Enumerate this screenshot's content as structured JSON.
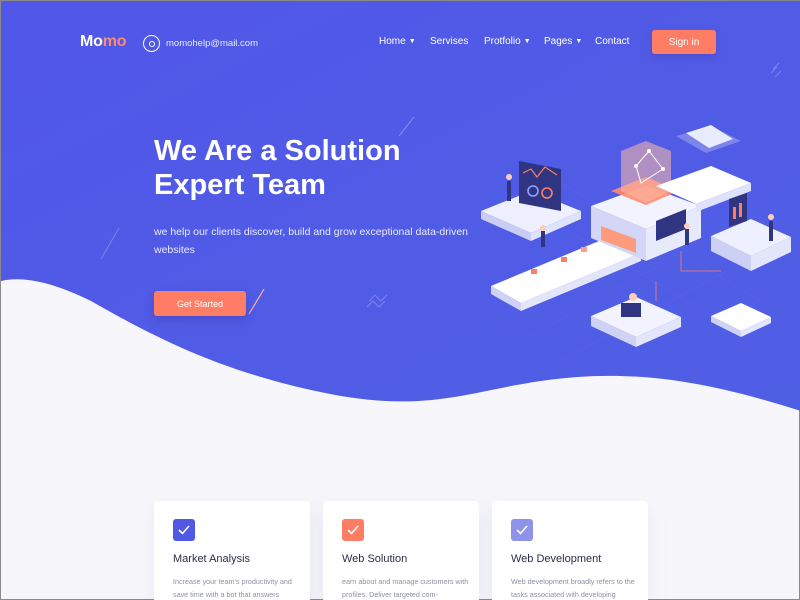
{
  "brand": {
    "logo_main": "Mo",
    "logo_accent": "mo",
    "accent_color": "#ff7d64",
    "primary_color": "#5158e6"
  },
  "header": {
    "email_icon": "at-icon",
    "email": "momohelp@mail.com",
    "nav": [
      {
        "label": "Home",
        "has_dropdown": true
      },
      {
        "label": "Servises",
        "has_dropdown": false
      },
      {
        "label": "Protfolio",
        "has_dropdown": true
      },
      {
        "label": "Pages",
        "has_dropdown": true
      },
      {
        "label": "Contact",
        "has_dropdown": false
      }
    ],
    "signin_label": "Sign in"
  },
  "hero": {
    "title_line1": "We Are a Solution",
    "title_line2": "Expert Team",
    "subtitle": "we help our clients discover, build and grow exceptional data-driven websites",
    "cta_label": "Get Started"
  },
  "cards": [
    {
      "icon": "checkmark-icon",
      "icon_color": "#5158e6",
      "title": "Market Analysis",
      "text": "Increase your team's productivity and save time with a bot that answers"
    },
    {
      "icon": "checkmark-icon",
      "icon_color": "#ff7d64",
      "title": "Web Solution",
      "text": "earn about and manage customers with profiles. Deliver targeted com-"
    },
    {
      "icon": "checkmark-icon",
      "icon_color": "#8f93e8",
      "title": "Web Development",
      "text": "Web development broadly refers to the tasks associated with developing"
    }
  ]
}
